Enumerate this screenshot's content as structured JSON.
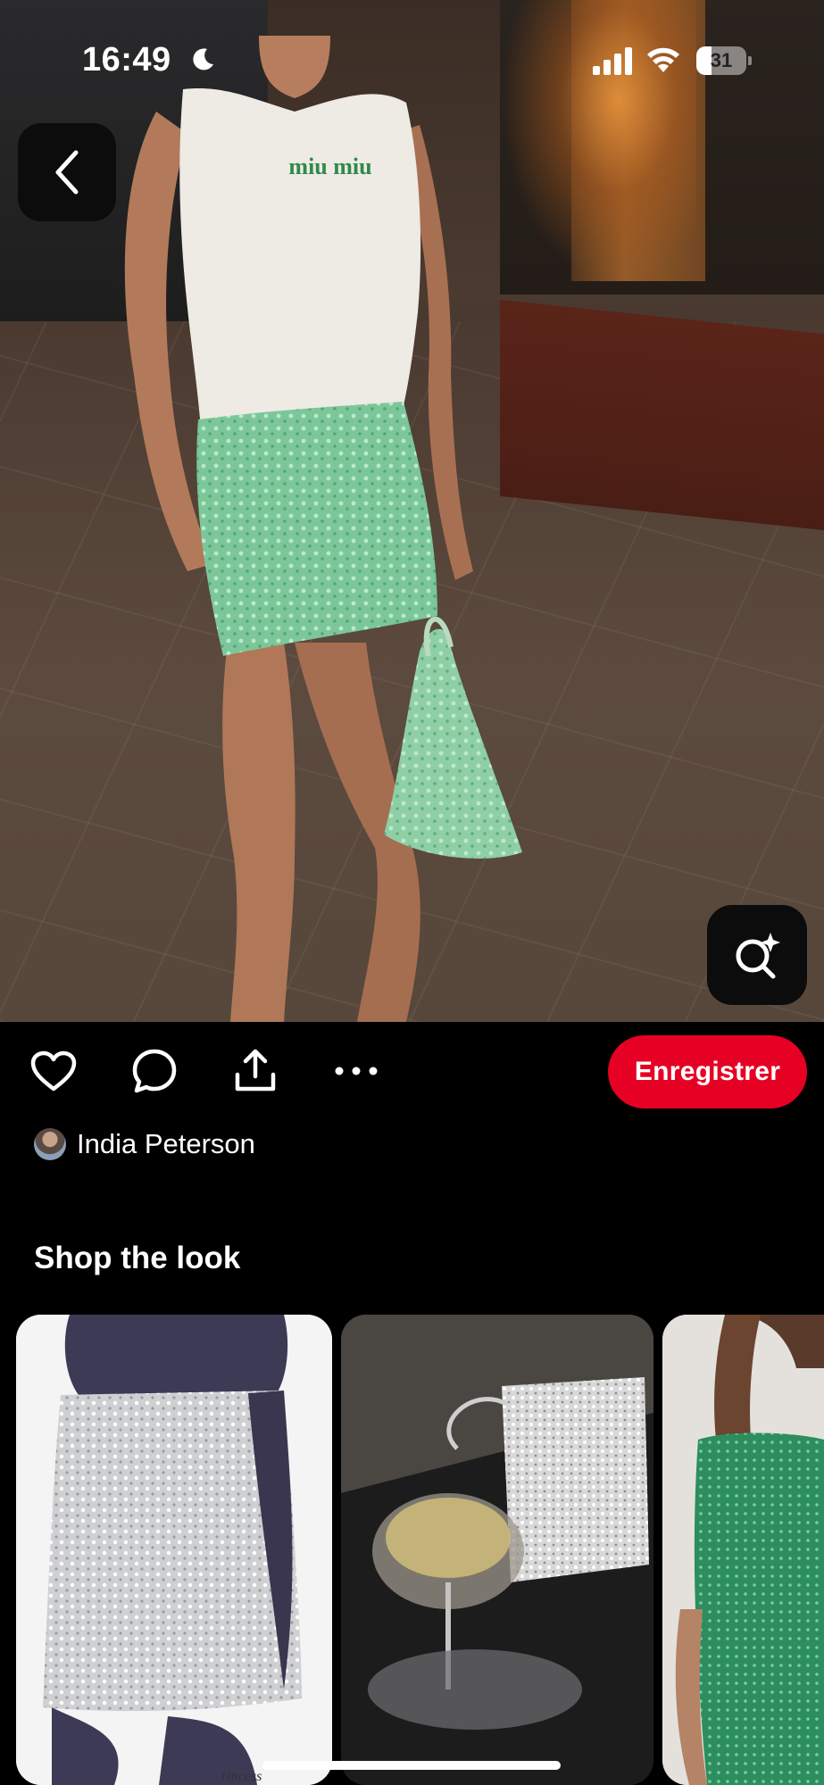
{
  "status_bar": {
    "time": "16:49",
    "battery_level": "31",
    "battery_fraction": 0.31,
    "icons": [
      "moon-icon",
      "cellular-signal-icon",
      "wifi-icon",
      "battery-icon"
    ]
  },
  "pin": {
    "image_icon": "photo-of-woman-in-green-sequin-skirt",
    "back_icon": "chevron-left-icon",
    "visual_search_icon": "visual-search-sparkle-icon"
  },
  "actions": {
    "icons": [
      "heart-icon",
      "comment-icon",
      "share-icon",
      "more-icon"
    ],
    "save_label": "Enregistrer",
    "save_color": "#e60023"
  },
  "author": {
    "name": "India Peterson"
  },
  "shop": {
    "title": "Shop the look",
    "products": [
      {
        "icon": "silver-sequin-wrap-skirt-image",
        "caption": "rincess"
      },
      {
        "icon": "silver-sequin-handbag-image"
      },
      {
        "icon": "green-sequin-dress-image"
      }
    ]
  },
  "colors": {
    "background": "#000000",
    "accent": "#e60023",
    "text": "#ffffff"
  }
}
